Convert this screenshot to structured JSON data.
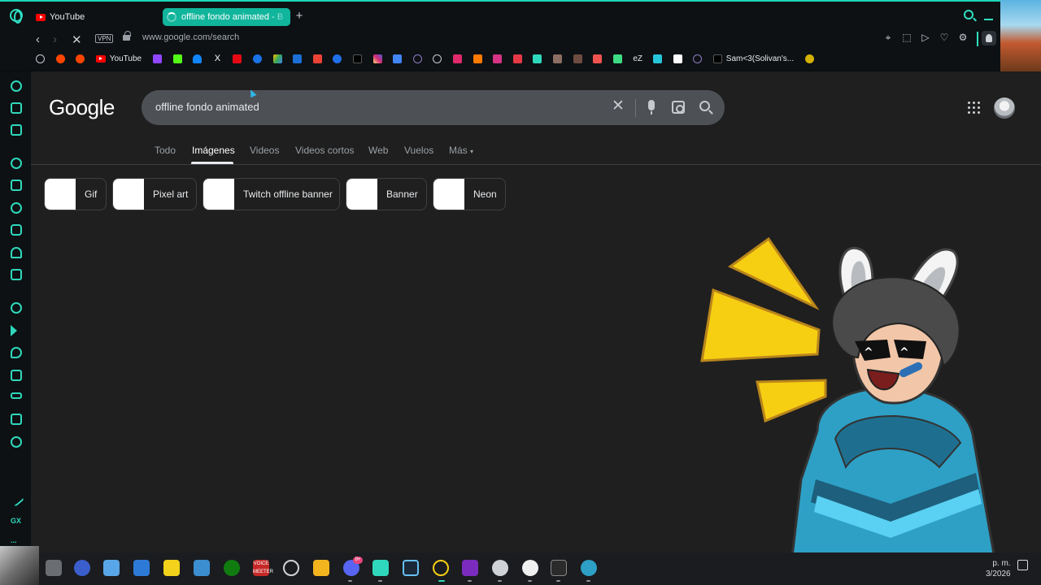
{
  "browser": {
    "tabs": [
      {
        "label": "YouTube",
        "icon": "youtube-icon"
      },
      {
        "label": "offline fondo animated - B",
        "icon": "loading-spinner-icon"
      }
    ],
    "url": "www.google.com/search",
    "vpn_label": "VPN"
  },
  "bookmarks": {
    "youtube_label": "YouTube",
    "ez_label": "eZ",
    "tiktok_label": "Sam<3(Solivan's..."
  },
  "sidebar": {
    "gx_label": "GX",
    "more_label": "..."
  },
  "google": {
    "logo": "Google",
    "query": "offline fondo animated",
    "tabs": [
      {
        "label": "Todo"
      },
      {
        "label": "Imágenes"
      },
      {
        "label": "Videos"
      },
      {
        "label": "Videos cortos"
      },
      {
        "label": "Web"
      },
      {
        "label": "Vuelos"
      },
      {
        "label": "Más"
      }
    ],
    "active_tab": "Imágenes",
    "chips": [
      {
        "label": "Gif"
      },
      {
        "label": "Pixel art"
      },
      {
        "label": "Twitch offline banner"
      },
      {
        "label": "Banner"
      },
      {
        "label": "Neon"
      }
    ]
  },
  "taskbar": {
    "discord_badge": "9+",
    "voicemeeter_label": "VOICE MEETER",
    "clock_line1": "p. m.",
    "clock_line2": "3/2026"
  },
  "colors": {
    "accent": "#1dd6b7",
    "page_bg": "#1f1f1f",
    "searchbox_bg": "#4d5156"
  }
}
